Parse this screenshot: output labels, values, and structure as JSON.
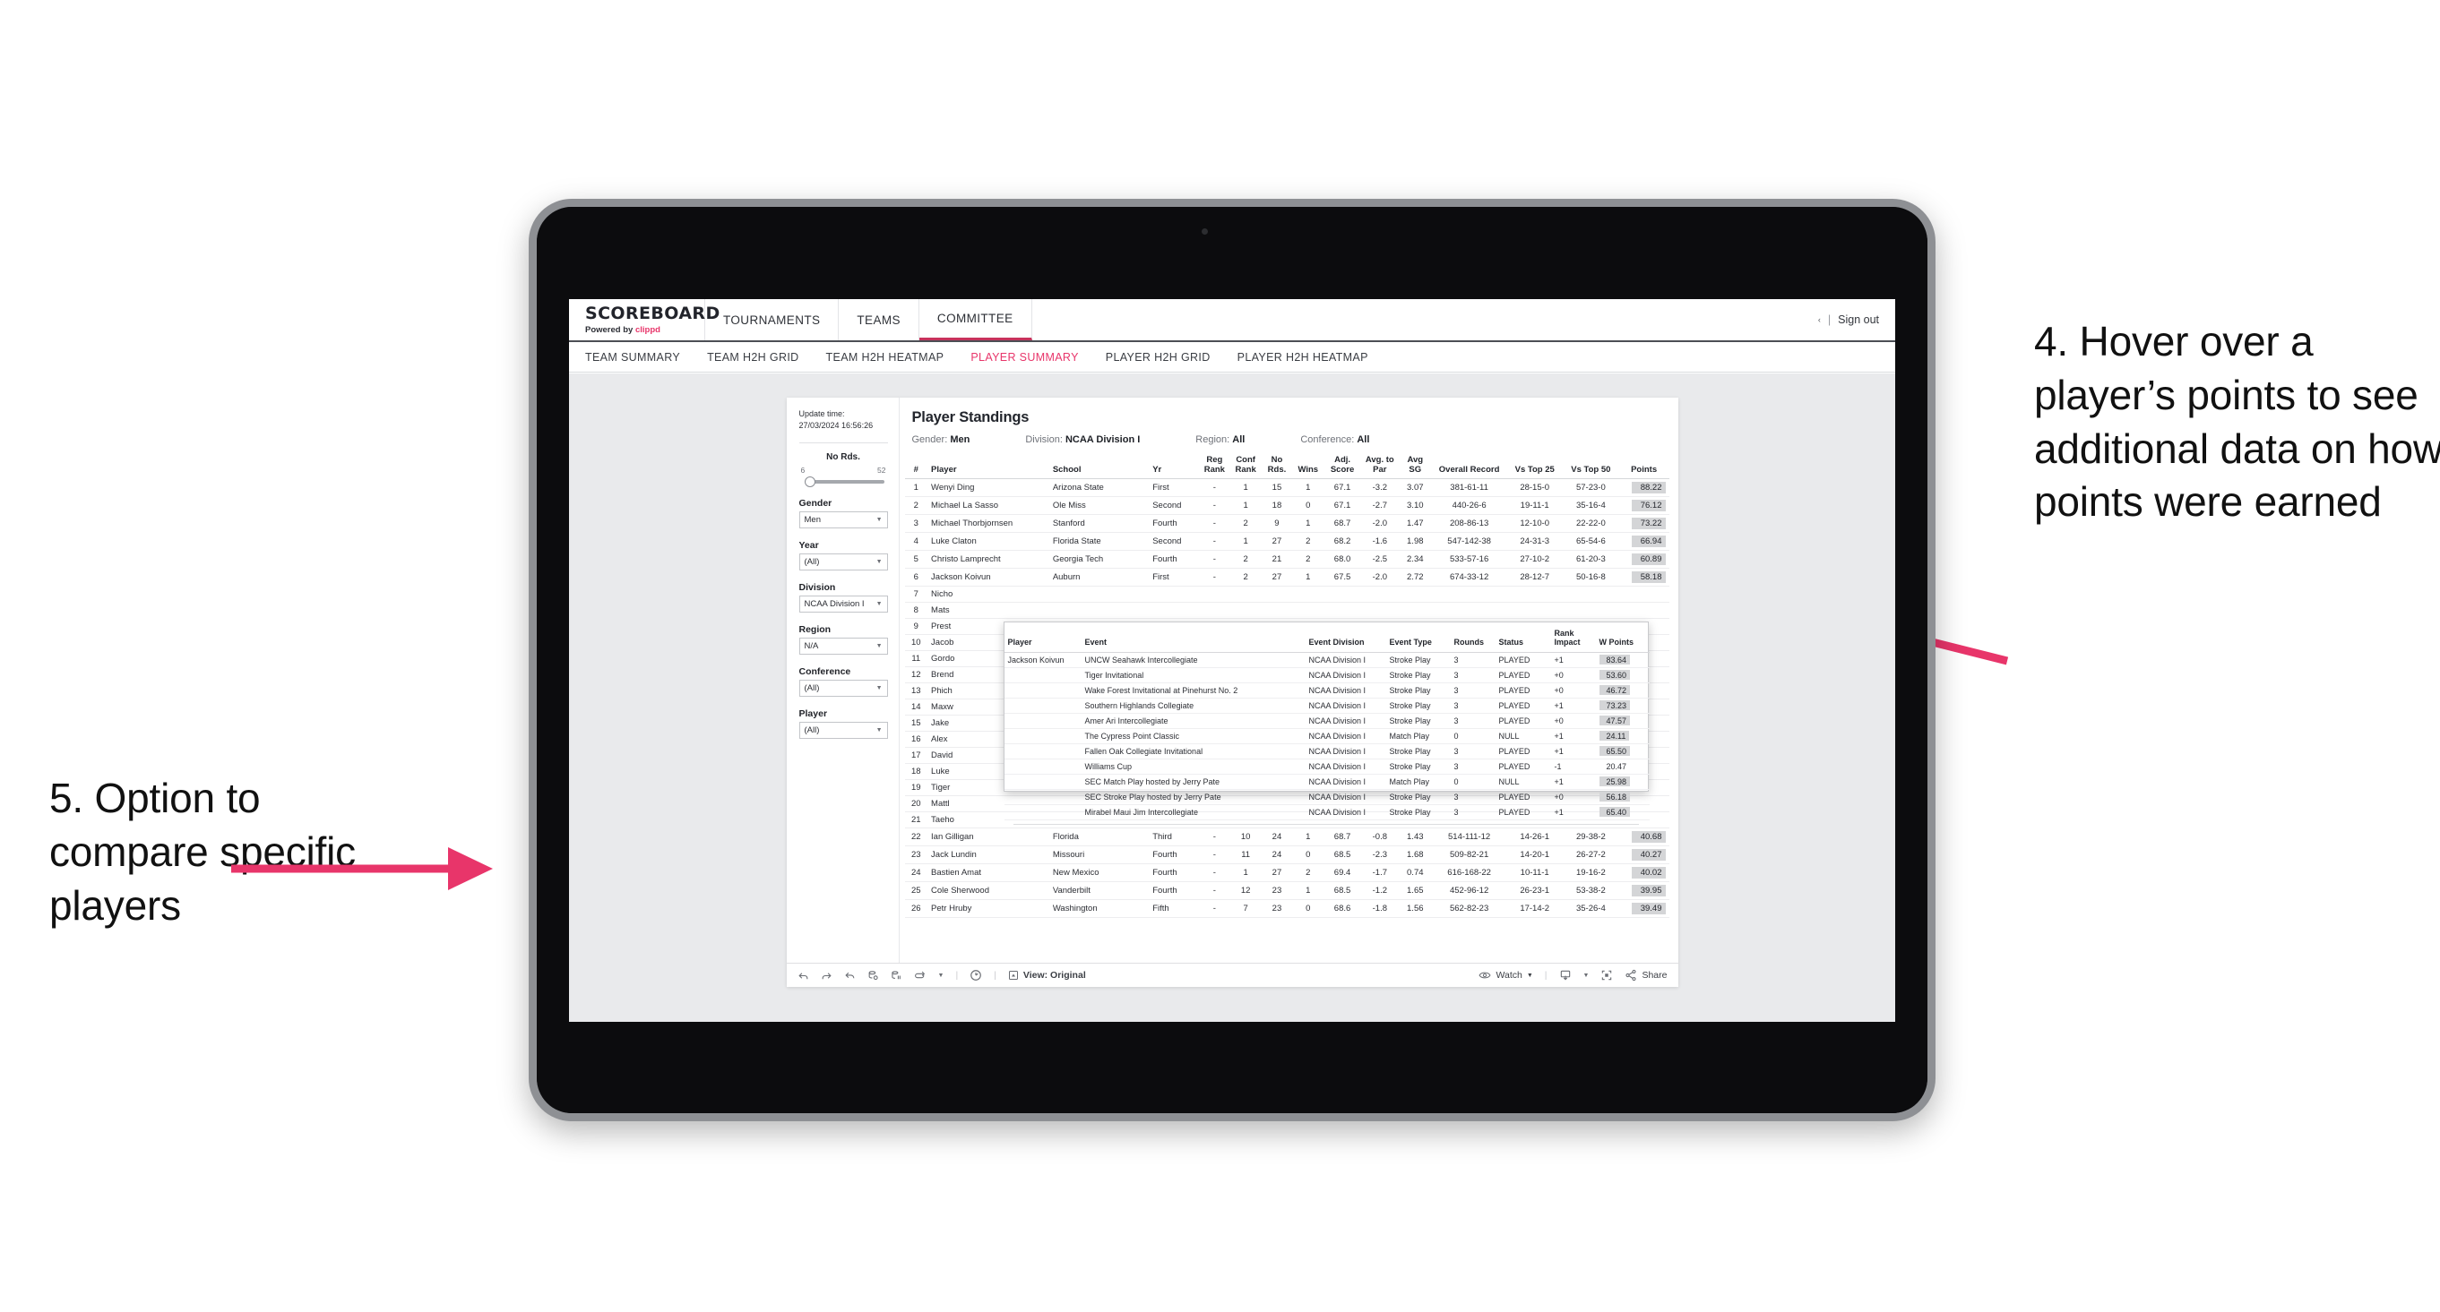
{
  "annotations": {
    "right": "4. Hover over a player’s points to see additional data on how points were earned",
    "left": "5. Option to compare specific players",
    "arrow_color": "#e8356a"
  },
  "app": {
    "brand": {
      "title": "SCOREBOARD",
      "powered_prefix": "Powered by ",
      "powered_brand": "clippd"
    },
    "topnav": [
      {
        "label": "TOURNAMENTS",
        "active": false
      },
      {
        "label": "TEAMS",
        "active": false
      },
      {
        "label": "COMMITTEE",
        "active": true
      }
    ],
    "header_right": {
      "icon": "‹",
      "separator": "|",
      "signout": "Sign out"
    },
    "subnav": [
      {
        "label": "TEAM SUMMARY",
        "active": false
      },
      {
        "label": "TEAM H2H GRID",
        "active": false
      },
      {
        "label": "TEAM H2H HEATMAP",
        "active": false
      },
      {
        "label": "PLAYER SUMMARY",
        "active": true
      },
      {
        "label": "PLAYER H2H GRID",
        "active": false
      },
      {
        "label": "PLAYER H2H HEATMAP",
        "active": false
      }
    ]
  },
  "sidebar": {
    "update_time_label": "Update time:",
    "update_time_value": "27/03/2024 16:56:26",
    "slider": {
      "title": "No Rds.",
      "min": "6",
      "max": "52"
    },
    "filters": [
      {
        "label": "Gender",
        "value": "Men"
      },
      {
        "label": "Year",
        "value": "(All)"
      },
      {
        "label": "Division",
        "value": "NCAA Division I"
      },
      {
        "label": "Region",
        "value": "N/A"
      },
      {
        "label": "Conference",
        "value": "(All)"
      },
      {
        "label": "Player",
        "value": "(All)"
      }
    ]
  },
  "viz": {
    "title": "Player Standings",
    "filters": [
      {
        "label": "Gender:",
        "value": "Men"
      },
      {
        "label": "Division:",
        "value": "NCAA Division I"
      },
      {
        "label": "Region:",
        "value": "All"
      },
      {
        "label": "Conference:",
        "value": "All"
      }
    ]
  },
  "table": {
    "columns": [
      "#",
      "Player",
      "School",
      "Yr",
      "Reg Rank",
      "Conf Rank",
      "No Rds.",
      "Wins",
      "Adj. Score",
      "Avg. to Par",
      "Avg SG",
      "Overall Record",
      "Vs Top 25",
      "Vs Top 50",
      "Points"
    ],
    "rows": [
      {
        "rank": "1",
        "player": "Wenyi Ding",
        "school": "Arizona State",
        "yr": "First",
        "reg": "-",
        "conf": "1",
        "rds": "15",
        "wins": "1",
        "adj": "67.1",
        "par": "-3.2",
        "sg": "3.07",
        "rec": "381-61-11",
        "t25": "28-15-0",
        "t50": "57-23-0",
        "pts": "88.22"
      },
      {
        "rank": "2",
        "player": "Michael La Sasso",
        "school": "Ole Miss",
        "yr": "Second",
        "reg": "-",
        "conf": "1",
        "rds": "18",
        "wins": "0",
        "adj": "67.1",
        "par": "-2.7",
        "sg": "3.10",
        "rec": "440-26-6",
        "t25": "19-11-1",
        "t50": "35-16-4",
        "pts": "76.12"
      },
      {
        "rank": "3",
        "player": "Michael Thorbjornsen",
        "school": "Stanford",
        "yr": "Fourth",
        "reg": "-",
        "conf": "2",
        "rds": "9",
        "wins": "1",
        "adj": "68.7",
        "par": "-2.0",
        "sg": "1.47",
        "rec": "208-86-13",
        "t25": "12-10-0",
        "t50": "22-22-0",
        "pts": "73.22"
      },
      {
        "rank": "4",
        "player": "Luke Claton",
        "school": "Florida State",
        "yr": "Second",
        "reg": "-",
        "conf": "1",
        "rds": "27",
        "wins": "2",
        "adj": "68.2",
        "par": "-1.6",
        "sg": "1.98",
        "rec": "547-142-38",
        "t25": "24-31-3",
        "t50": "65-54-6",
        "pts": "66.94"
      },
      {
        "rank": "5",
        "player": "Christo Lamprecht",
        "school": "Georgia Tech",
        "yr": "Fourth",
        "reg": "-",
        "conf": "2",
        "rds": "21",
        "wins": "2",
        "adj": "68.0",
        "par": "-2.5",
        "sg": "2.34",
        "rec": "533-57-16",
        "t25": "27-10-2",
        "t50": "61-20-3",
        "pts": "60.89"
      },
      {
        "rank": "6",
        "player": "Jackson Koivun",
        "school": "Auburn",
        "yr": "First",
        "reg": "-",
        "conf": "2",
        "rds": "27",
        "wins": "1",
        "adj": "67.5",
        "par": "-2.0",
        "sg": "2.72",
        "rec": "674-33-12",
        "t25": "28-12-7",
        "t50": "50-16-8",
        "pts": "58.18"
      },
      {
        "rank": "7",
        "player": "Nicho",
        "school": "",
        "yr": "",
        "reg": "",
        "conf": "",
        "rds": "",
        "wins": "",
        "adj": "",
        "par": "",
        "sg": "",
        "rec": "",
        "t25": "",
        "t50": "",
        "pts": ""
      },
      {
        "rank": "8",
        "player": "Mats",
        "school": "",
        "yr": "",
        "reg": "",
        "conf": "",
        "rds": "",
        "wins": "",
        "adj": "",
        "par": "",
        "sg": "",
        "rec": "",
        "t25": "",
        "t50": "",
        "pts": ""
      },
      {
        "rank": "9",
        "player": "Prest",
        "school": "",
        "yr": "",
        "reg": "",
        "conf": "",
        "rds": "",
        "wins": "",
        "adj": "",
        "par": "",
        "sg": "",
        "rec": "",
        "t25": "",
        "t50": "",
        "pts": ""
      },
      {
        "rank": "10",
        "player": "Jacob",
        "school": "",
        "yr": "",
        "reg": "",
        "conf": "",
        "rds": "",
        "wins": "",
        "adj": "",
        "par": "",
        "sg": "",
        "rec": "",
        "t25": "",
        "t50": "",
        "pts": ""
      },
      {
        "rank": "11",
        "player": "Gordo",
        "school": "",
        "yr": "",
        "reg": "",
        "conf": "",
        "rds": "",
        "wins": "",
        "adj": "",
        "par": "",
        "sg": "",
        "rec": "",
        "t25": "",
        "t50": "",
        "pts": ""
      },
      {
        "rank": "12",
        "player": "Brend",
        "school": "",
        "yr": "",
        "reg": "",
        "conf": "",
        "rds": "",
        "wins": "",
        "adj": "",
        "par": "",
        "sg": "",
        "rec": "",
        "t25": "",
        "t50": "",
        "pts": ""
      },
      {
        "rank": "13",
        "player": "Phich",
        "school": "",
        "yr": "",
        "reg": "",
        "conf": "",
        "rds": "",
        "wins": "",
        "adj": "",
        "par": "",
        "sg": "",
        "rec": "",
        "t25": "",
        "t50": "",
        "pts": ""
      },
      {
        "rank": "14",
        "player": "Maxw",
        "school": "",
        "yr": "",
        "reg": "",
        "conf": "",
        "rds": "",
        "wins": "",
        "adj": "",
        "par": "",
        "sg": "",
        "rec": "",
        "t25": "",
        "t50": "",
        "pts": ""
      },
      {
        "rank": "15",
        "player": "Jake",
        "school": "",
        "yr": "",
        "reg": "",
        "conf": "",
        "rds": "",
        "wins": "",
        "adj": "",
        "par": "",
        "sg": "",
        "rec": "",
        "t25": "",
        "t50": "",
        "pts": ""
      },
      {
        "rank": "16",
        "player": "Alex",
        "school": "",
        "yr": "",
        "reg": "",
        "conf": "",
        "rds": "",
        "wins": "",
        "adj": "",
        "par": "",
        "sg": "",
        "rec": "",
        "t25": "",
        "t50": "",
        "pts": ""
      },
      {
        "rank": "17",
        "player": "David",
        "school": "",
        "yr": "",
        "reg": "",
        "conf": "",
        "rds": "",
        "wins": "",
        "adj": "",
        "par": "",
        "sg": "",
        "rec": "",
        "t25": "",
        "t50": "",
        "pts": ""
      },
      {
        "rank": "18",
        "player": "Luke",
        "school": "",
        "yr": "",
        "reg": "",
        "conf": "",
        "rds": "",
        "wins": "",
        "adj": "",
        "par": "",
        "sg": "",
        "rec": "",
        "t25": "",
        "t50": "",
        "pts": ""
      },
      {
        "rank": "19",
        "player": "Tiger",
        "school": "",
        "yr": "",
        "reg": "",
        "conf": "",
        "rds": "",
        "wins": "",
        "adj": "",
        "par": "",
        "sg": "",
        "rec": "",
        "t25": "",
        "t50": "",
        "pts": ""
      },
      {
        "rank": "20",
        "player": "Mattl",
        "school": "",
        "yr": "",
        "reg": "",
        "conf": "",
        "rds": "",
        "wins": "",
        "adj": "",
        "par": "",
        "sg": "",
        "rec": "",
        "t25": "",
        "t50": "",
        "pts": ""
      },
      {
        "rank": "21",
        "player": "Taeho",
        "school": "",
        "yr": "",
        "reg": "",
        "conf": "",
        "rds": "",
        "wins": "",
        "adj": "",
        "par": "",
        "sg": "",
        "rec": "",
        "t25": "",
        "t50": "",
        "pts": ""
      },
      {
        "rank": "22",
        "player": "Ian Gilligan",
        "school": "Florida",
        "yr": "Third",
        "reg": "-",
        "conf": "10",
        "rds": "24",
        "wins": "1",
        "adj": "68.7",
        "par": "-0.8",
        "sg": "1.43",
        "rec": "514-111-12",
        "t25": "14-26-1",
        "t50": "29-38-2",
        "pts": "40.68"
      },
      {
        "rank": "23",
        "player": "Jack Lundin",
        "school": "Missouri",
        "yr": "Fourth",
        "reg": "-",
        "conf": "11",
        "rds": "24",
        "wins": "0",
        "adj": "68.5",
        "par": "-2.3",
        "sg": "1.68",
        "rec": "509-82-21",
        "t25": "14-20-1",
        "t50": "26-27-2",
        "pts": "40.27"
      },
      {
        "rank": "24",
        "player": "Bastien Amat",
        "school": "New Mexico",
        "yr": "Fourth",
        "reg": "-",
        "conf": "1",
        "rds": "27",
        "wins": "2",
        "adj": "69.4",
        "par": "-1.7",
        "sg": "0.74",
        "rec": "616-168-22",
        "t25": "10-11-1",
        "t50": "19-16-2",
        "pts": "40.02"
      },
      {
        "rank": "25",
        "player": "Cole Sherwood",
        "school": "Vanderbilt",
        "yr": "Fourth",
        "reg": "-",
        "conf": "12",
        "rds": "23",
        "wins": "1",
        "adj": "68.5",
        "par": "-1.2",
        "sg": "1.65",
        "rec": "452-96-12",
        "t25": "26-23-1",
        "t50": "53-38-2",
        "pts": "39.95"
      },
      {
        "rank": "26",
        "player": "Petr Hruby",
        "school": "Washington",
        "yr": "Fifth",
        "reg": "-",
        "conf": "7",
        "rds": "23",
        "wins": "0",
        "adj": "68.6",
        "par": "-1.8",
        "sg": "1.56",
        "rec": "562-82-23",
        "t25": "17-14-2",
        "t50": "35-26-4",
        "pts": "39.49"
      }
    ]
  },
  "tooltip": {
    "columns": [
      "Player",
      "Event",
      "Event Division",
      "Event Type",
      "Rounds",
      "Status",
      "Rank Impact",
      "W Points"
    ],
    "player": "Jackson Koivun",
    "rows": [
      {
        "event": "UNCW Seahawk Intercollegiate",
        "division": "NCAA Division I",
        "type": "Stroke Play",
        "rounds": "3",
        "status": "PLAYED",
        "impact": "+1",
        "wpoints": "83.64",
        "highlight": true
      },
      {
        "event": "Tiger Invitational",
        "division": "NCAA Division I",
        "type": "Stroke Play",
        "rounds": "3",
        "status": "PLAYED",
        "impact": "+0",
        "wpoints": "53.60",
        "highlight": true
      },
      {
        "event": "Wake Forest Invitational at Pinehurst No. 2",
        "division": "NCAA Division I",
        "type": "Stroke Play",
        "rounds": "3",
        "status": "PLAYED",
        "impact": "+0",
        "wpoints": "46.72",
        "highlight": true
      },
      {
        "event": "Southern Highlands Collegiate",
        "division": "NCAA Division I",
        "type": "Stroke Play",
        "rounds": "3",
        "status": "PLAYED",
        "impact": "+1",
        "wpoints": "73.23",
        "highlight": true
      },
      {
        "event": "Amer Ari Intercollegiate",
        "division": "NCAA Division I",
        "type": "Stroke Play",
        "rounds": "3",
        "status": "PLAYED",
        "impact": "+0",
        "wpoints": "47.57",
        "highlight": true
      },
      {
        "event": "The Cypress Point Classic",
        "division": "NCAA Division I",
        "type": "Match Play",
        "rounds": "0",
        "status": "NULL",
        "impact": "+1",
        "wpoints": "24.11",
        "highlight": true
      },
      {
        "event": "Fallen Oak Collegiate Invitational",
        "division": "NCAA Division I",
        "type": "Stroke Play",
        "rounds": "3",
        "status": "PLAYED",
        "impact": "+1",
        "wpoints": "65.50",
        "highlight": true
      },
      {
        "event": "Williams Cup",
        "division": "NCAA Division I",
        "type": "Stroke Play",
        "rounds": "3",
        "status": "PLAYED",
        "impact": "-1",
        "wpoints": "20.47",
        "highlight": false
      },
      {
        "event": "SEC Match Play hosted by Jerry Pate",
        "division": "NCAA Division I",
        "type": "Match Play",
        "rounds": "0",
        "status": "NULL",
        "impact": "+1",
        "wpoints": "25.98",
        "highlight": true
      },
      {
        "event": "SEC Stroke Play hosted by Jerry Pate",
        "division": "NCAA Division I",
        "type": "Stroke Play",
        "rounds": "3",
        "status": "PLAYED",
        "impact": "+0",
        "wpoints": "56.18",
        "highlight": true
      },
      {
        "event": "Mirabel Maui Jim Intercollegiate",
        "division": "NCAA Division I",
        "type": "Stroke Play",
        "rounds": "3",
        "status": "PLAYED",
        "impact": "+1",
        "wpoints": "65.40",
        "highlight": true
      }
    ]
  },
  "toolbar": {
    "left_icons": [
      "undo-icon",
      "redo-icon",
      "revert-icon",
      "refresh-data-icon",
      "pause-icon",
      "subscribe-icon",
      "caret-icon"
    ],
    "alert_icon": "alert-icon",
    "view_label": "View: Original",
    "watch_label": "Watch",
    "share_label": "Share"
  }
}
